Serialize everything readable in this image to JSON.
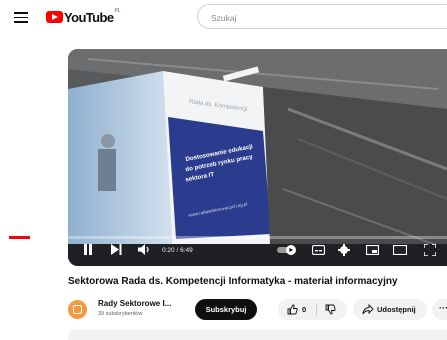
{
  "header": {
    "logo_text": "YouTube",
    "region_code": "PL",
    "search_placeholder": "Szukaj"
  },
  "player": {
    "time_current": "0:20",
    "time_separator": " / ",
    "time_total": "6:49",
    "progress_fraction": 0.049,
    "poster_lines": [
      "Dostosowanie edukacji",
      "do potrzeb rynku pracy",
      "sektora IT"
    ],
    "poster_url": "www.radasektorowa.pcl.org.pl",
    "banner_text": "Rada ds. Kompetencji"
  },
  "video": {
    "title": "Sektorowa Rada ds. Kompetencji Informatyka - materiał informacyjny"
  },
  "channel": {
    "name": "Rady Sektorowe I...",
    "subscribers": "39 subskrybentów",
    "subscribe_label": "Subskrybuj"
  },
  "actions": {
    "like_count": "0",
    "share_label": "Udostępnij",
    "more_label": "···"
  },
  "colors": {
    "brand_red": "#ff0000",
    "channel_avatar": "#f29a3d",
    "poster_blue": "#2b3c8e"
  }
}
